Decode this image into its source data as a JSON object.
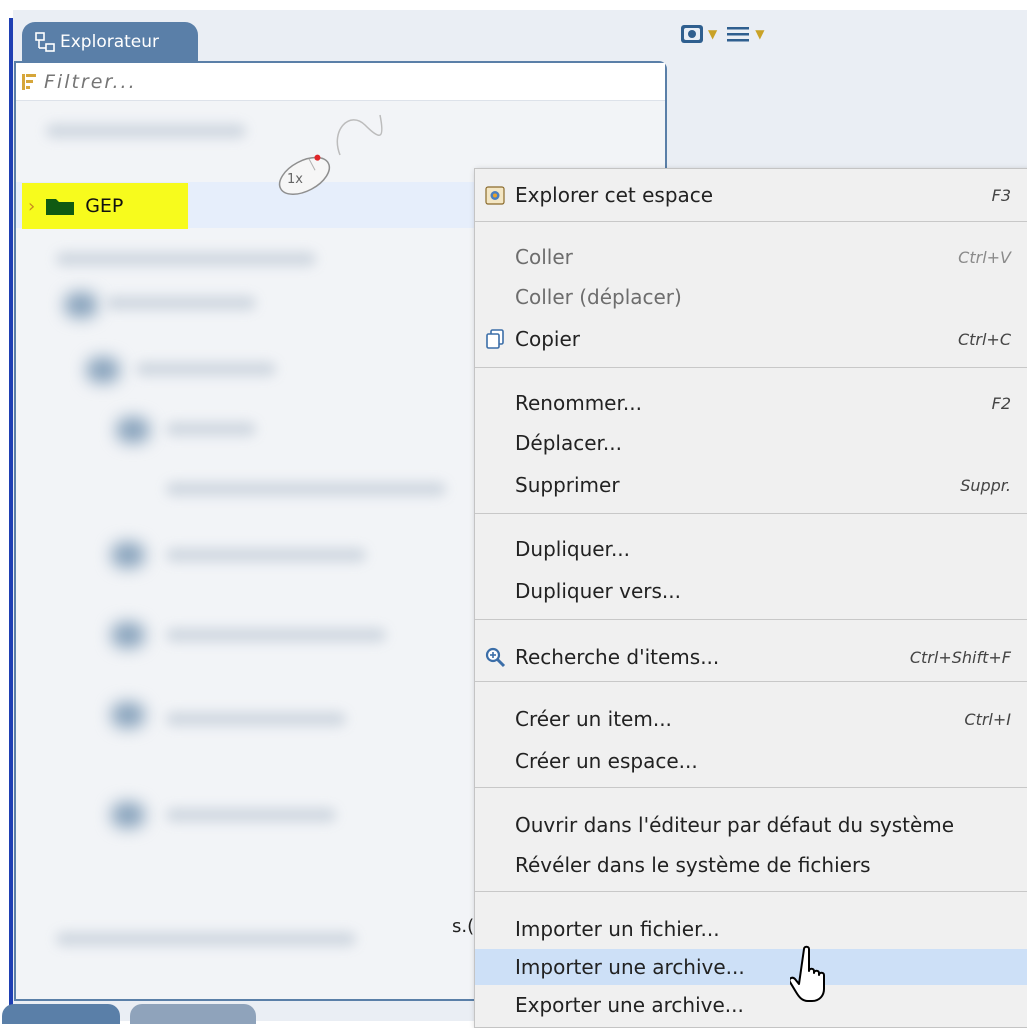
{
  "panel": {
    "tab_label": "Explorateur",
    "filter_placeholder": "Filtrer...",
    "selected_item": "GEP",
    "partial_text": "s.(",
    "click_badge": "1x"
  },
  "context_menu": {
    "explore": {
      "label": "Explorer cet espace",
      "shortcut": "F3"
    },
    "paste": {
      "label": "Coller",
      "shortcut": "Ctrl+V"
    },
    "paste_move": {
      "label": "Coller (déplacer)",
      "shortcut": ""
    },
    "copy": {
      "label": "Copier",
      "shortcut": "Ctrl+C"
    },
    "rename": {
      "label": "Renommer...",
      "shortcut": "F2"
    },
    "move": {
      "label": "Déplacer...",
      "shortcut": ""
    },
    "delete": {
      "label": "Supprimer",
      "shortcut": "Suppr."
    },
    "duplicate": {
      "label": "Dupliquer...",
      "shortcut": ""
    },
    "duplicate_to": {
      "label": "Dupliquer vers...",
      "shortcut": ""
    },
    "search_items": {
      "label": "Recherche d'items...",
      "shortcut": "Ctrl+Shift+F"
    },
    "create_item": {
      "label": "Créer un item...",
      "shortcut": "Ctrl+I"
    },
    "create_space": {
      "label": "Créer un espace...",
      "shortcut": ""
    },
    "open_default_editor": {
      "label": "Ouvrir dans l'éditeur par défaut du système",
      "shortcut": ""
    },
    "reveal_in_fs": {
      "label": "Révéler dans le système de fichiers",
      "shortcut": ""
    },
    "import_file": {
      "label": "Importer un fichier...",
      "shortcut": ""
    },
    "import_archive": {
      "label": "Importer une archive...",
      "shortcut": ""
    },
    "export_archive": {
      "label": "Exporter une archive...",
      "shortcut": ""
    }
  },
  "colors": {
    "tab": "#5a7fa8",
    "highlight": "#f7fb1d",
    "menu_hover": "#cde0f7",
    "folder": "#0f5a12"
  },
  "icons": {
    "tab": "explorer-tree-icon",
    "filter": "filter-icon",
    "folder": "folder-icon",
    "toolbar_view": "view-toggle-icon",
    "toolbar_menu": "hamburger-menu-icon",
    "explore": "explore-space-icon",
    "copy": "copy-icon",
    "search": "search-zoom-icon",
    "cursor": "hand-pointer-icon"
  }
}
